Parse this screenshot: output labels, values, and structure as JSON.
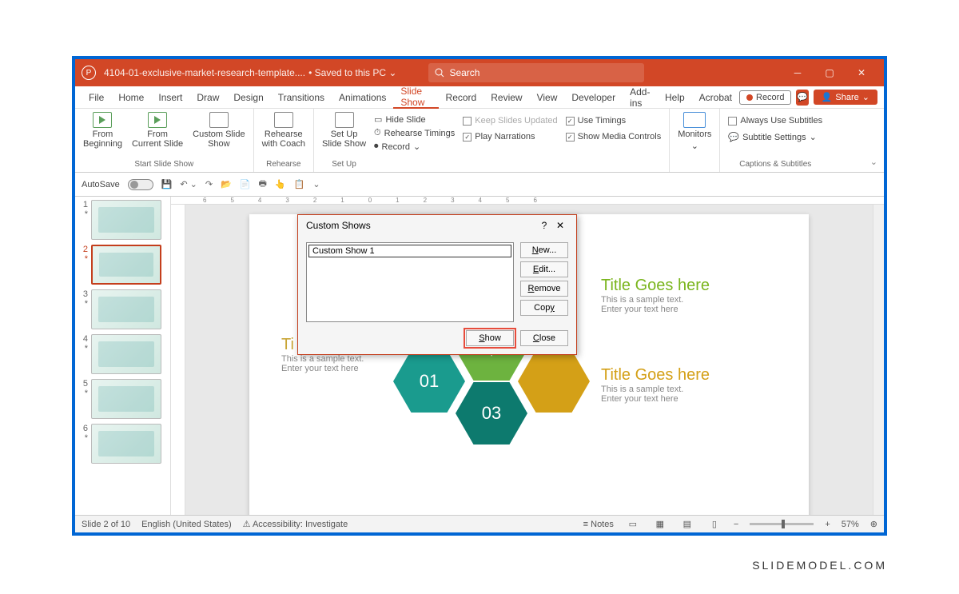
{
  "titlebar": {
    "filename": "4104-01-exclusive-market-research-template....",
    "saved_status": "Saved to this PC",
    "search_placeholder": "Search"
  },
  "menu": {
    "tabs": [
      "File",
      "Home",
      "Insert",
      "Draw",
      "Design",
      "Transitions",
      "Animations",
      "Slide Show",
      "Record",
      "Review",
      "View",
      "Developer",
      "Add-ins",
      "Help",
      "Acrobat"
    ],
    "active_index": 7,
    "record_btn": "Record",
    "share_btn": "Share"
  },
  "ribbon": {
    "group1_label": "Start Slide Show",
    "from_beginning": "From\nBeginning",
    "from_current": "From\nCurrent Slide",
    "custom_show": "Custom Slide\nShow",
    "group2_label": "Rehearse",
    "rehearse_coach": "Rehearse\nwith Coach",
    "group3_label": "Set Up",
    "setup_show": "Set Up\nSlide Show",
    "hide_slide": "Hide Slide",
    "rehearse_timings": "Rehearse Timings",
    "record_dd": "Record",
    "keep_updated": "Keep Slides Updated",
    "use_timings": "Use Timings",
    "play_narrations": "Play Narrations",
    "show_media": "Show Media Controls",
    "monitors": "Monitors",
    "group5_label": "Captions & Subtitles",
    "always_subtitles": "Always Use Subtitles",
    "subtitle_settings": "Subtitle Settings"
  },
  "qat": {
    "autosave_label": "AutoSave"
  },
  "thumbs": [
    1,
    2,
    3,
    4,
    5,
    6
  ],
  "slide": {
    "left_title": "Ti",
    "left_sample1": "This is a sample text.",
    "left_sample2": "Enter your text here",
    "right_title1": "Title Goes here",
    "right_sample1a": "This is a sample text.",
    "right_sample1b": "Enter your text here",
    "right_title2": "Title Goes here",
    "right_sample2a": "This is a sample text.",
    "right_sample2b": "Enter your text here",
    "hex1": "01",
    "hex2": "$",
    "hex3": "03"
  },
  "dialog": {
    "title": "Custom Shows",
    "list_item": "Custom Show 1",
    "new_btn": "New...",
    "edit_btn": "Edit...",
    "remove_btn": "Remove",
    "copy_btn": "Copy",
    "show_btn": "Show",
    "close_btn": "Close"
  },
  "status": {
    "slide_info": "Slide 2 of 10",
    "language": "English (United States)",
    "accessibility": "Accessibility: Investigate",
    "notes": "Notes",
    "zoom": "57%"
  },
  "watermark": "SLIDEMODEL.COM",
  "ruler_marks": [
    "6",
    "5",
    "4",
    "3",
    "2",
    "1",
    "0",
    "1",
    "2",
    "3",
    "4",
    "5",
    "6"
  ]
}
